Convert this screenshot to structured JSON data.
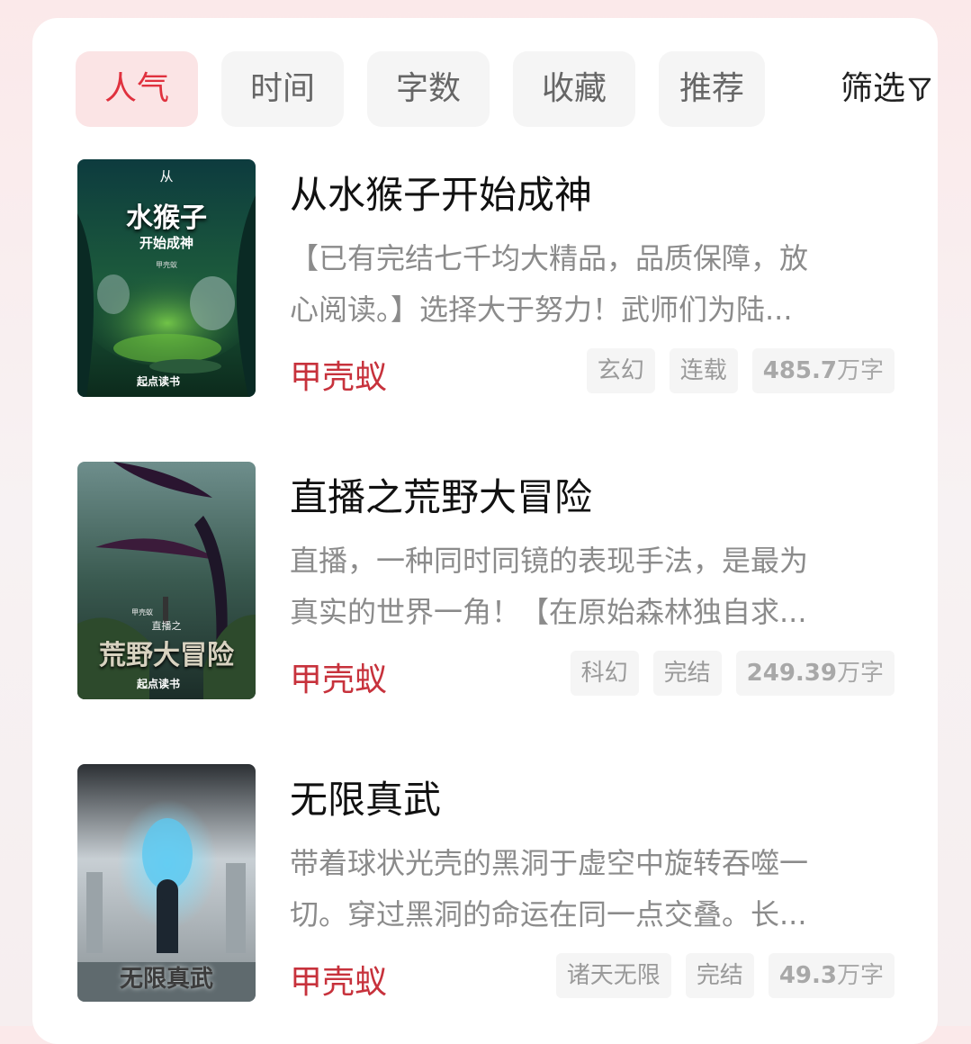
{
  "tabs": [
    {
      "label": "人气",
      "active": true
    },
    {
      "label": "时间",
      "active": false
    },
    {
      "label": "字数",
      "active": false
    },
    {
      "label": "收藏",
      "active": false
    },
    {
      "label": "推荐",
      "active": false
    }
  ],
  "filter": {
    "label": "筛选",
    "icon": "funnel-icon"
  },
  "books": [
    {
      "title": "从水猴子开始成神",
      "desc_line1": "【已有完结七千均大精品，品质保障，放",
      "desc_line2": "心阅读。】选择大于努力！武师们为陆...",
      "author": "甲壳蚁",
      "tags": [
        "玄幻",
        "连载"
      ],
      "word_count": "485.7",
      "word_unit": "万字",
      "cover": {
        "small": "从",
        "main": "水猴子",
        "sub": "开始成神",
        "author": "甲壳蚁",
        "publisher": "起点读书"
      }
    },
    {
      "title": "直播之荒野大冒险",
      "desc_line1": "直播，一种同时同镜的表现手法，是最为",
      "desc_line2": "真实的世界一角！【在原始森林独自求...",
      "author": "甲壳蚁",
      "tags": [
        "科幻",
        "完结"
      ],
      "word_count": "249.39",
      "word_unit": "万字",
      "cover": {
        "author": "甲壳蚁",
        "sub": "直播之",
        "main": "荒野大冒险",
        "publisher": "起点读书"
      }
    },
    {
      "title": "无限真武",
      "desc_line1": "带着球状光壳的黑洞于虚空中旋转吞噬一",
      "desc_line2": "切。穿过黑洞的命运在同一点交叠。长...",
      "author": "甲壳蚁",
      "tags": [
        "诸天无限",
        "完结"
      ],
      "word_count": "49.3",
      "word_unit": "万字",
      "cover": {
        "main": "无限真武"
      }
    }
  ]
}
